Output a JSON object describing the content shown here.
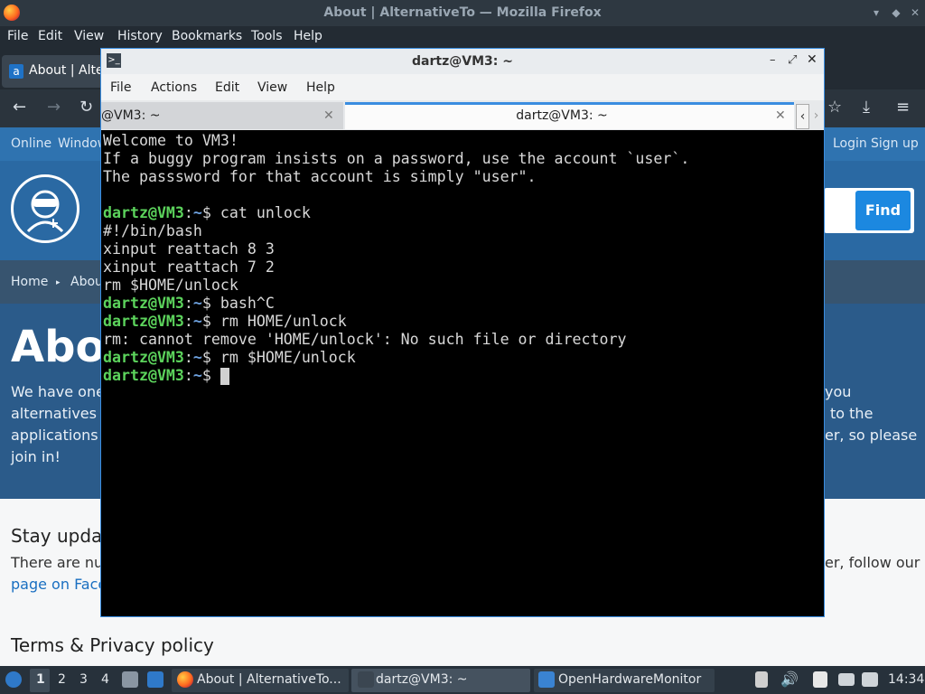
{
  "firefox": {
    "window_title": "About | AlternativeTo — Mozilla Firefox",
    "menu": [
      "File",
      "Edit",
      "View",
      "History",
      "Bookmarks",
      "Tools",
      "Help"
    ],
    "tab_label": "About | Alternat",
    "tab_favicon": "a"
  },
  "page": {
    "top_links": {
      "online": "Online",
      "windows": "Window",
      "login": "Login",
      "signup": "Sign up"
    },
    "find_button": "Find",
    "breadcrumb": {
      "home": "Home",
      "about": "Abou"
    },
    "heading": "Abou",
    "para_lines": [
      {
        "left": "We have one r",
        "right": "you"
      },
      {
        "left": "alternatives to",
        "right": "to the"
      },
      {
        "left": "applications y",
        "right": "er, so please"
      },
      {
        "left": "join in!",
        "right": ""
      }
    ],
    "stay_heading": "Stay upda",
    "stay_line1_left": "There are num",
    "stay_line1_right": "er, follow our",
    "stay_line2_link": "page on Faceb",
    "terms_heading": "Terms & Privacy policy"
  },
  "terminal": {
    "title": "dartz@VM3: ~",
    "menu": [
      "File",
      "Actions",
      "Edit",
      "View",
      "Help"
    ],
    "tab1": "@VM3: ~",
    "tab2": "dartz@VM3: ~",
    "prompt_user": "dartz@VM3",
    "prompt_sep": ":",
    "prompt_path": "~",
    "prompt_end": "$",
    "lines": [
      {
        "kind": "out",
        "text": "Welcome to VM3!"
      },
      {
        "kind": "out",
        "text": "If a buggy program insists on a password, use the account `user`."
      },
      {
        "kind": "out",
        "text": "The passsword for that account is simply \"user\"."
      },
      {
        "kind": "out",
        "text": ""
      },
      {
        "kind": "cmd",
        "text": " cat unlock"
      },
      {
        "kind": "out",
        "text": "#!/bin/bash"
      },
      {
        "kind": "out",
        "text": "xinput reattach 8 3"
      },
      {
        "kind": "out",
        "text": "xinput reattach 7 2"
      },
      {
        "kind": "out",
        "text": "rm $HOME/unlock"
      },
      {
        "kind": "cmd",
        "text": " bash^C"
      },
      {
        "kind": "cmd",
        "text": " rm HOME/unlock"
      },
      {
        "kind": "out",
        "text": "rm: cannot remove 'HOME/unlock': No such file or directory"
      },
      {
        "kind": "cmd",
        "text": " rm $HOME/unlock"
      },
      {
        "kind": "cmd",
        "text": " "
      }
    ]
  },
  "taskbar": {
    "workspaces": [
      "1",
      "2",
      "3",
      "4"
    ],
    "firefox_task": "About | AlternativeTo...",
    "terminal_task": "dartz@VM3: ~",
    "ohm_task": "OpenHardwareMonitor",
    "clock": "14:34"
  },
  "icons": [
    "firefox-icon",
    "terminal-icon",
    "folder-icon",
    "speaker-icon",
    "clipboard-icon",
    "display-icon",
    "network-icon",
    "start-menu-icon",
    "back-icon",
    "forward-icon",
    "reload-icon",
    "bookmark-star-icon",
    "download-icon",
    "hamburger-menu-icon"
  ]
}
